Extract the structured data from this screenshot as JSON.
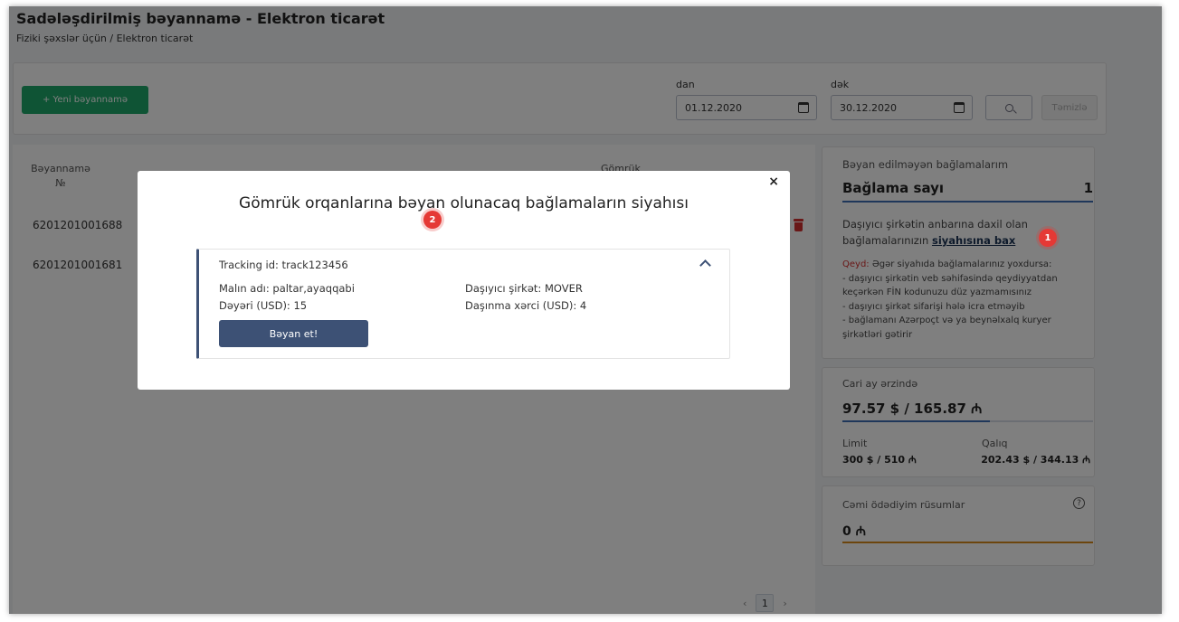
{
  "header": {
    "title": "Sadələşdirilmiş bəyannamə - Elektron ticarət",
    "breadcrumb": "Fiziki şəxslər üçün / Elektron ticarət"
  },
  "filters": {
    "new_button": "+ Yeni bəyannamə",
    "from_label": "dan",
    "to_label": "dək",
    "from_value": "01.12.2020",
    "to_value": "30.12.2020",
    "clear_button": "Təmizlə"
  },
  "table": {
    "col1_line1": "Bəyannamə",
    "col1_line2": "№",
    "col2_partial": "Gömrük",
    "rows": [
      "6201201001688",
      "6201201001681"
    ]
  },
  "pagination": {
    "prev": "‹",
    "page": "1",
    "next": "›"
  },
  "side_undeclared": {
    "title": "Bəyan edilməyən bağlamalarım",
    "count_label": "Bağlama sayı",
    "count_value": "1",
    "info_text": "Daşıyıcı şirkətin anbarına daxil olan bağlamalarınızın",
    "info_link": "siyahısına bax",
    "note_label": "Qeyd:",
    "note_text": "Əgər siyahıda bağlamalarınız yoxdursa:",
    "note_items": [
      "- daşıyıcı şirkətin veb səhifəsində qeydiyyatdan keçərkən FİN kodunuzu düz yazmamısınız",
      "- daşıyıcı şirkət sifarişi hələ icra etməyib",
      "- bağlamanı Azərpoçt və ya beynəlxalq kuryer şirkətləri gətirir"
    ]
  },
  "side_month": {
    "title": "Cari ay ərzində",
    "amount": "97.57 $ / 165.87 ₼",
    "progress": 0.59,
    "limit_label": "Limit",
    "limit_value": "300 $ / 510 ₼",
    "rest_label": "Qalıq",
    "rest_value": "202.43 $ / 344.13 ₼"
  },
  "side_paid": {
    "title": "Cəmi ödədiyim rüsumlar",
    "help_icon": "?",
    "amount": "0 ₼"
  },
  "badges": {
    "one": "1",
    "two": "2"
  },
  "modal": {
    "close": "×",
    "title": "Gömrük orqanlarına bəyan olunacaq bağlamaların siyahısı",
    "tracking": "Tracking id: track123456",
    "goods_label": "Malın adı:",
    "goods_value": "paltar,ayaqqabi",
    "value_label": "Dəyəri (USD):",
    "value_value": "15",
    "carrier_label": "Daşıyıcı şirkət:",
    "carrier_value": "MOVER",
    "ship_label": "Daşınma xərci (USD):",
    "ship_value": "4",
    "declare_button": "Bəyan et!"
  },
  "colors": {
    "primary_green": "#1ea86a",
    "navy": "#3d5175",
    "danger": "#d32f2f",
    "progress_blue": "#3f6fb5",
    "underline_orange": "#d98b1b"
  }
}
